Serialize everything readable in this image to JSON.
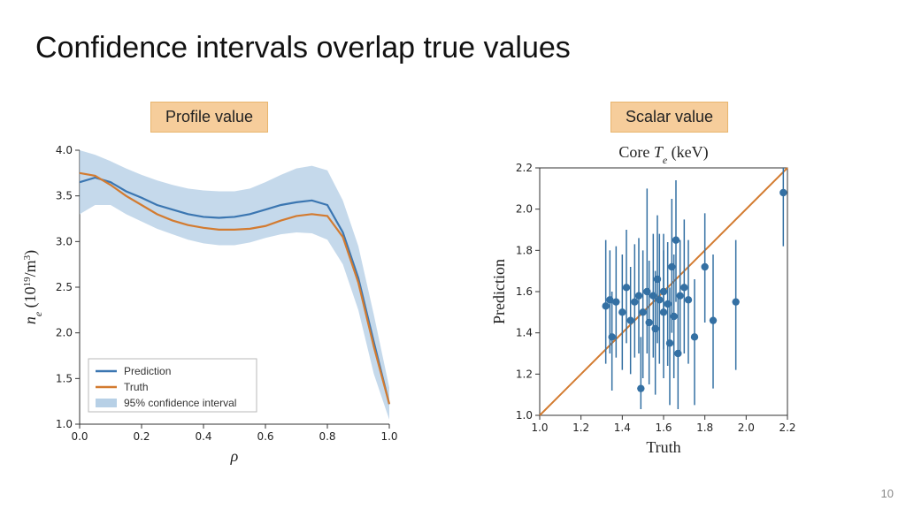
{
  "slide": {
    "title": "Confidence intervals overlap true values",
    "page_number": "10",
    "label_profile": "Profile value",
    "label_scalar": "Scalar value"
  },
  "colors": {
    "prediction": "#3b76b1",
    "truth": "#d37b30",
    "ci_fill": "#b7d0e6",
    "marker": "#3470a3"
  },
  "chart_data": [
    {
      "id": "profile",
      "type": "line",
      "title": "",
      "xlabel": "ρ",
      "ylabel": "nₑ (10¹⁹/m³)",
      "xlim": [
        0.0,
        1.0
      ],
      "ylim": [
        1.0,
        4.0
      ],
      "x_ticks": [
        0.0,
        0.2,
        0.4,
        0.6,
        0.8,
        1.0
      ],
      "y_ticks": [
        1.0,
        1.5,
        2.0,
        2.5,
        3.0,
        3.5,
        4.0
      ],
      "legend": [
        "Prediction",
        "Truth",
        "95% confidence interval"
      ],
      "x": [
        0.0,
        0.05,
        0.1,
        0.15,
        0.2,
        0.25,
        0.3,
        0.35,
        0.4,
        0.45,
        0.5,
        0.55,
        0.6,
        0.65,
        0.7,
        0.75,
        0.8,
        0.85,
        0.9,
        0.95,
        1.0
      ],
      "series": [
        {
          "name": "Prediction",
          "values": [
            3.65,
            3.7,
            3.65,
            3.55,
            3.48,
            3.4,
            3.35,
            3.3,
            3.27,
            3.26,
            3.27,
            3.3,
            3.35,
            3.4,
            3.43,
            3.45,
            3.4,
            3.1,
            2.6,
            1.9,
            1.22
          ]
        },
        {
          "name": "Truth",
          "values": [
            3.75,
            3.72,
            3.62,
            3.5,
            3.4,
            3.3,
            3.23,
            3.18,
            3.15,
            3.13,
            3.13,
            3.14,
            3.17,
            3.23,
            3.28,
            3.3,
            3.28,
            3.05,
            2.55,
            1.85,
            1.22
          ]
        }
      ],
      "ci_upper": [
        4.0,
        3.95,
        3.88,
        3.8,
        3.73,
        3.67,
        3.62,
        3.58,
        3.56,
        3.55,
        3.55,
        3.58,
        3.65,
        3.73,
        3.8,
        3.83,
        3.78,
        3.45,
        2.95,
        2.2,
        1.4
      ],
      "ci_lower": [
        3.3,
        3.4,
        3.4,
        3.3,
        3.22,
        3.14,
        3.08,
        3.02,
        2.98,
        2.96,
        2.96,
        2.99,
        3.04,
        3.08,
        3.1,
        3.09,
        3.02,
        2.75,
        2.25,
        1.55,
        1.05
      ]
    },
    {
      "id": "scalar",
      "type": "scatter",
      "title": "Core Tₑ (keV)",
      "xlabel": "Truth",
      "ylabel": "Prediction",
      "xlim": [
        1.0,
        2.2
      ],
      "ylim": [
        1.0,
        2.2
      ],
      "x_ticks": [
        1.0,
        1.2,
        1.4,
        1.6,
        1.8,
        2.0,
        2.2
      ],
      "y_ticks": [
        1.0,
        1.2,
        1.4,
        1.6,
        1.8,
        2.0,
        2.2
      ],
      "diagonal": {
        "x0": 1.0,
        "y0": 1.0,
        "x1": 2.2,
        "y1": 2.2
      },
      "points": [
        {
          "x": 1.32,
          "y": 1.53,
          "lo": 1.25,
          "hi": 1.85
        },
        {
          "x": 1.34,
          "y": 1.56,
          "lo": 1.3,
          "hi": 1.8
        },
        {
          "x": 1.35,
          "y": 1.38,
          "lo": 1.12,
          "hi": 1.6
        },
        {
          "x": 1.37,
          "y": 1.55,
          "lo": 1.28,
          "hi": 1.82
        },
        {
          "x": 1.4,
          "y": 1.5,
          "lo": 1.22,
          "hi": 1.78
        },
        {
          "x": 1.42,
          "y": 1.62,
          "lo": 1.35,
          "hi": 1.9
        },
        {
          "x": 1.44,
          "y": 1.46,
          "lo": 1.2,
          "hi": 1.72
        },
        {
          "x": 1.46,
          "y": 1.55,
          "lo": 1.28,
          "hi": 1.83
        },
        {
          "x": 1.48,
          "y": 1.58,
          "lo": 1.3,
          "hi": 1.86
        },
        {
          "x": 1.49,
          "y": 1.13,
          "lo": 1.03,
          "hi": 1.38
        },
        {
          "x": 1.5,
          "y": 1.5,
          "lo": 1.18,
          "hi": 1.8
        },
        {
          "x": 1.52,
          "y": 1.6,
          "lo": 1.3,
          "hi": 2.1
        },
        {
          "x": 1.53,
          "y": 1.45,
          "lo": 1.15,
          "hi": 1.75
        },
        {
          "x": 1.55,
          "y": 1.58,
          "lo": 1.28,
          "hi": 1.88
        },
        {
          "x": 1.56,
          "y": 1.42,
          "lo": 1.1,
          "hi": 1.7
        },
        {
          "x": 1.57,
          "y": 1.66,
          "lo": 1.35,
          "hi": 1.97
        },
        {
          "x": 1.58,
          "y": 1.56,
          "lo": 1.25,
          "hi": 1.88
        },
        {
          "x": 1.6,
          "y": 1.6,
          "lo": 1.32,
          "hi": 1.88
        },
        {
          "x": 1.6,
          "y": 1.5,
          "lo": 1.18,
          "hi": 1.8
        },
        {
          "x": 1.62,
          "y": 1.54,
          "lo": 1.24,
          "hi": 1.84
        },
        {
          "x": 1.63,
          "y": 1.35,
          "lo": 1.05,
          "hi": 1.62
        },
        {
          "x": 1.64,
          "y": 1.72,
          "lo": 1.4,
          "hi": 2.05
        },
        {
          "x": 1.65,
          "y": 1.48,
          "lo": 1.18,
          "hi": 1.78
        },
        {
          "x": 1.66,
          "y": 1.85,
          "lo": 1.55,
          "hi": 2.14
        },
        {
          "x": 1.67,
          "y": 1.3,
          "lo": 1.03,
          "hi": 1.58
        },
        {
          "x": 1.68,
          "y": 1.58,
          "lo": 1.3,
          "hi": 1.85
        },
        {
          "x": 1.7,
          "y": 1.62,
          "lo": 1.3,
          "hi": 1.95
        },
        {
          "x": 1.72,
          "y": 1.56,
          "lo": 1.25,
          "hi": 1.85
        },
        {
          "x": 1.75,
          "y": 1.38,
          "lo": 1.05,
          "hi": 1.66
        },
        {
          "x": 1.8,
          "y": 1.72,
          "lo": 1.45,
          "hi": 1.98
        },
        {
          "x": 1.84,
          "y": 1.46,
          "lo": 1.13,
          "hi": 1.78
        },
        {
          "x": 1.95,
          "y": 1.55,
          "lo": 1.22,
          "hi": 1.85
        },
        {
          "x": 2.18,
          "y": 2.08,
          "lo": 1.82,
          "hi": 2.2
        }
      ]
    }
  ]
}
